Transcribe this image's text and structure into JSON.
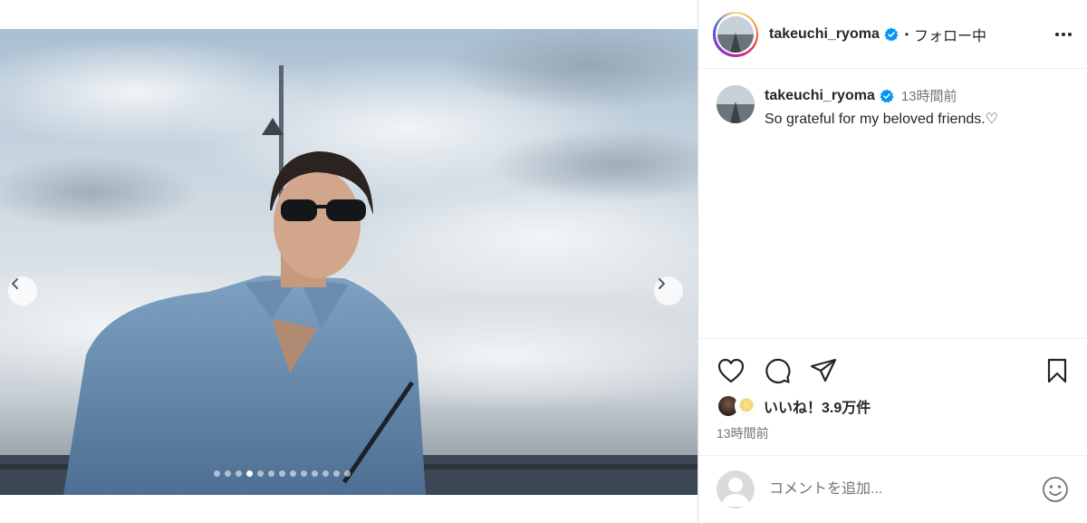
{
  "post": {
    "username": "takeuchi_ryoma",
    "verified": true,
    "separator": "•",
    "follow_label": "フォロー中",
    "more_icon": "more-horizontal-icon",
    "caption": {
      "username": "takeuchi_ryoma",
      "time_ago": "13時間前",
      "text": "So grateful for my beloved friends.♡"
    },
    "likes_label": "いいね！3.9万件",
    "timestamp": "13時間前",
    "comment_placeholder": "コメントを追加..."
  },
  "carousel": {
    "slide_count": 13,
    "active_index": 3,
    "prev_icon": "chevron-left-icon",
    "next_icon": "chevron-right-icon"
  },
  "colors": {
    "verified_badge": "#0095f6",
    "text_primary": "#262626",
    "text_secondary": "#737373",
    "divider": "#dbdbdb"
  }
}
